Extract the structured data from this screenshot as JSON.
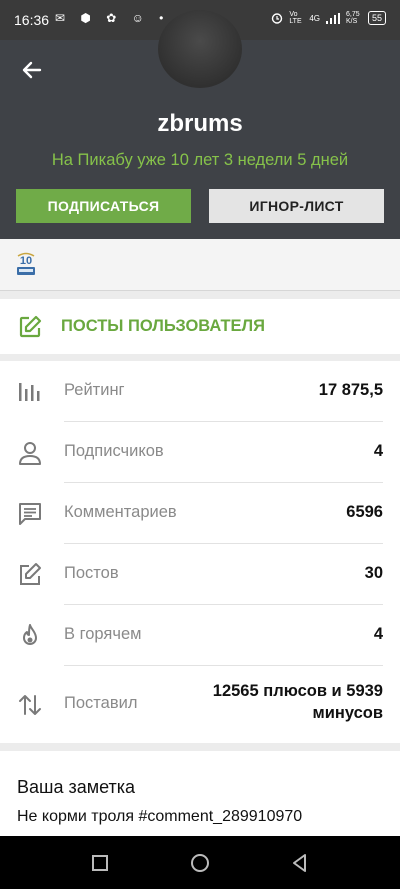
{
  "status_bar": {
    "time": "16:36",
    "notification_icons": "✉ ⬢ ✿ ☺ •",
    "network_volte": "Vo LTE",
    "network_4g": "4G",
    "speed": "6,75 K/S",
    "battery": "55"
  },
  "profile": {
    "username": "zbrums",
    "since": "На Пикабу уже 10 лет 3 недели 5 дней",
    "subscribe_label": "ПОДПИСАТЬСЯ",
    "ignore_label": "ИГНОР-ЛИСТ"
  },
  "posts_link": {
    "label": "ПОСТЫ ПОЛЬЗОВАТЕЛЯ"
  },
  "stats": [
    {
      "icon": "bar-chart-icon",
      "label": "Рейтинг",
      "value": "17 875,5"
    },
    {
      "icon": "person-icon",
      "label": "Подписчиков",
      "value": "4"
    },
    {
      "icon": "comment-icon",
      "label": "Комментариев",
      "value": "6596"
    },
    {
      "icon": "edit-icon",
      "label": "Постов",
      "value": "30"
    },
    {
      "icon": "fire-icon",
      "label": "В горячем",
      "value": "4"
    },
    {
      "icon": "sort-arrows-icon",
      "label": "Поставил",
      "value_line1": "12565 плюсов и 5939",
      "value_line2": "минусов"
    }
  ],
  "note": {
    "title": "Ваша заметка",
    "text": "Не корми троля #comment_289910970"
  },
  "colors": {
    "accent_green": "#70ab48",
    "header_bg": "#3f4247"
  }
}
